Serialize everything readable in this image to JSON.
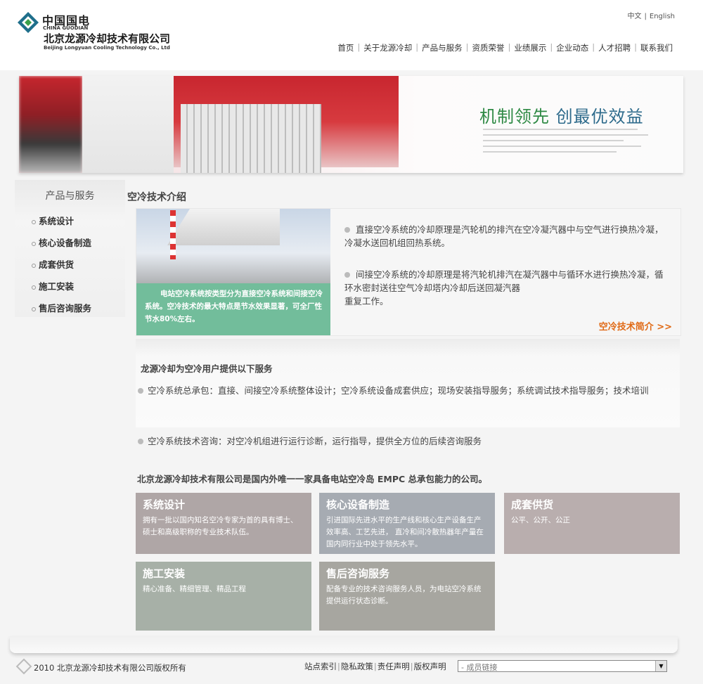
{
  "header": {
    "logo_cn": "中国国电",
    "logo_en": "CHINA GUODIAN",
    "company_cn": "北京龙源冷却技术有限公司",
    "company_en": "Beijing Longyuan Cooling Technology Co., Ltd",
    "lang_cn": "中文",
    "lang_sep": "|",
    "lang_en": "English",
    "nav": [
      "首页",
      "关于龙源冷却",
      "产品与服务",
      "资质荣誉",
      "业绩展示",
      "企业动态",
      "人才招聘",
      "联系我们"
    ]
  },
  "banner": {
    "slogan_a": "机制领先",
    "slogan_b": "创最优效益"
  },
  "sidebar": {
    "title": "产品与服务",
    "items": [
      "系统设计",
      "核心设备制造",
      "成套供货",
      "施工安装",
      "售后咨询服务"
    ]
  },
  "intro": {
    "title": "空冷技术介绍",
    "caption": "电站空冷系统按类型分为直接空冷系统和间接空冷系统。空冷技术的最大特点是节水效果显著，可全厂性节水80%左右。",
    "para1": "直接空冷系统的冷却原理是汽轮机的排汽在空冷凝汽器中与空气进行换热冷凝，冷凝水送回机组回热系统。",
    "para2": "间接空冷系统的冷却原理是将汽轮机排汽在凝汽器中与循环水进行换热冷凝，循环水密封送往空气冷却塔内冷却后送回凝汽器",
    "para2b": "重复工作。",
    "more": "空冷技术简介 >>"
  },
  "services": {
    "head": "龙源冷却为空冷用户提供以下服务",
    "item1": "空冷系统总承包：直接、间接空冷系统整体设计；空冷系统设备成套供应；现场安装指导服务；系统调试技术指导服务；技术培训",
    "item2": "空冷系统技术咨询：对空冷机组进行运行诊断，运行指导，提供全方位的后续咨询服务"
  },
  "statement": "北京龙源冷却技术有限公司是国内外唯一一家具备电站空冷岛 EMPC 总承包能力的公司。",
  "tiles": [
    {
      "title": "系统设计",
      "desc": "拥有一批以国内知名空冷专家为首的具有博士、硕士和高级职称的专业技术队伍。",
      "color": "#afa6a6"
    },
    {
      "title": "核心设备制造",
      "desc": "引进国际先进水平的生产线和核心生产设备生产效率高、工艺先进， 直冷和间冷散热器年产量在国内同行业中处于领先水平。",
      "color": "#a6abb2"
    },
    {
      "title": "成套供货",
      "desc": "公平、公开、公正",
      "color": "#b9aeae"
    },
    {
      "title": "施工安装",
      "desc": "精心准备、精细管理、精品工程",
      "color": "#a7b0a7"
    },
    {
      "title": "售后咨询服务",
      "desc": "配备专业的技术咨询服务人员，为电站空冷系统提供运行状态诊断。",
      "color": "#a7a6a0"
    }
  ],
  "footer": {
    "copyright": "2010 北京龙源冷却技术有限公司版权所有",
    "links": [
      "站点索引",
      "隐私政策",
      "责任声明",
      "版权声明"
    ],
    "select_value": "- 成员链接"
  }
}
